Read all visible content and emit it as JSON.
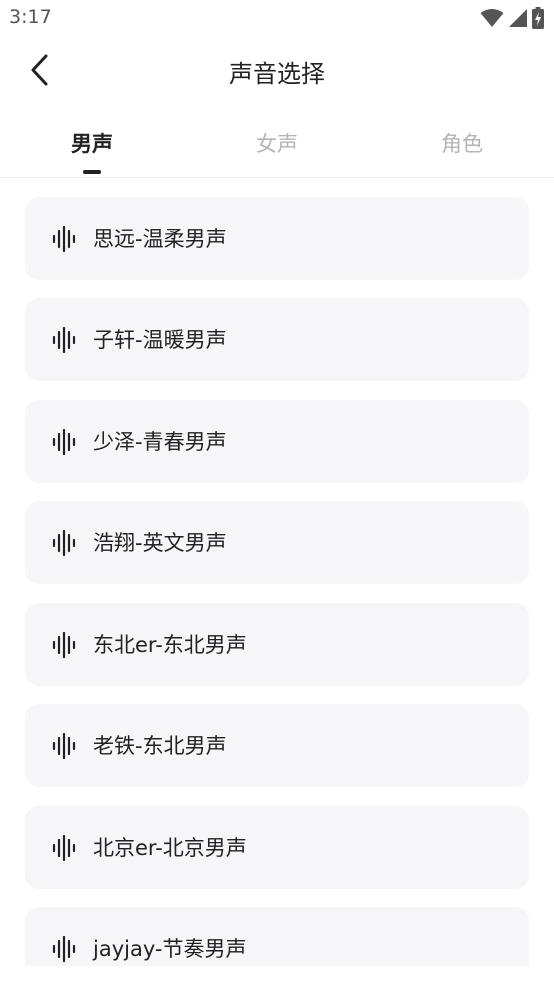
{
  "status_bar": {
    "time": "3:17",
    "icons": [
      "wifi-icon",
      "signal-icon",
      "battery-charging-icon"
    ]
  },
  "header": {
    "title": "声音选择",
    "back_icon": "chevron-left-icon"
  },
  "tabs": [
    {
      "label": "男声",
      "active": true
    },
    {
      "label": "女声",
      "active": false
    },
    {
      "label": "角色",
      "active": false
    }
  ],
  "voices": [
    {
      "label": "思远-温柔男声",
      "icon": "audio-wave-icon"
    },
    {
      "label": "子轩-温暖男声",
      "icon": "audio-wave-icon"
    },
    {
      "label": "少泽-青春男声",
      "icon": "audio-wave-icon"
    },
    {
      "label": "浩翔-英文男声",
      "icon": "audio-wave-icon"
    },
    {
      "label": "东北er-东北男声",
      "icon": "audio-wave-icon"
    },
    {
      "label": "老铁-东北男声",
      "icon": "audio-wave-icon"
    },
    {
      "label": "北京er-北京男声",
      "icon": "audio-wave-icon"
    },
    {
      "label": "jayjay-节奏男声",
      "icon": "audio-wave-icon"
    }
  ],
  "colors": {
    "text": "#222222",
    "inactive_tab": "#b4b4b4",
    "card_bg": "#f6f6f8",
    "divider": "#eeeeee"
  }
}
